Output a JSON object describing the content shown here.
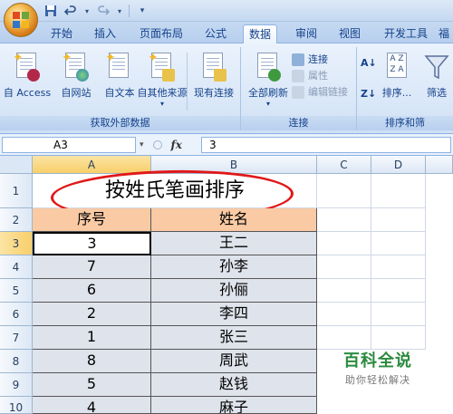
{
  "quick_access": {
    "save_icon": "save-icon",
    "undo_icon": "undo-icon",
    "redo_icon": "redo-icon",
    "customize_icon": "chevron-down-icon"
  },
  "tabs": [
    {
      "label": "开始"
    },
    {
      "label": "插入"
    },
    {
      "label": "页面布局"
    },
    {
      "label": "公式"
    },
    {
      "label": "数据",
      "active": true
    },
    {
      "label": "审阅"
    },
    {
      "label": "视图"
    },
    {
      "label": "开发工具"
    },
    {
      "label": "福"
    }
  ],
  "ribbon": {
    "get_external": {
      "label": "获取外部数据",
      "buttons": [
        "自 Access",
        "自网站",
        "自文本",
        "自其他来源",
        "现有连接"
      ]
    },
    "connections": {
      "label": "连接",
      "refresh_all": "全部刷新",
      "connect": "连接",
      "properties": "属性",
      "edit_links": "编辑链接"
    },
    "sort_filter": {
      "label": "排序和筛",
      "sort": "排序...",
      "filter": "筛选"
    }
  },
  "formula_bar": {
    "name_box": "A3",
    "fx_label": "fx",
    "formula": "3"
  },
  "sheet": {
    "columns": [
      "A",
      "B",
      "C",
      "D"
    ],
    "rows": [
      "1",
      "2",
      "3",
      "4",
      "5",
      "6",
      "7",
      "8",
      "9",
      "10"
    ],
    "title": "按姓氏笔画排序",
    "header": {
      "a": "序号",
      "b": "姓名"
    },
    "data": [
      {
        "no": "3",
        "name": "王二"
      },
      {
        "no": "7",
        "name": "孙李"
      },
      {
        "no": "6",
        "name": "孙俪"
      },
      {
        "no": "2",
        "name": "李四"
      },
      {
        "no": "1",
        "name": "张三"
      },
      {
        "no": "8",
        "name": "周武"
      },
      {
        "no": "5",
        "name": "赵钱"
      },
      {
        "no": "4",
        "name": "麻子"
      }
    ],
    "active_cell": "A3"
  },
  "watermark": {
    "title": "百科全说",
    "subtitle": "助你轻松解决"
  },
  "colors": {
    "ribbon_bg": "#dbe8f8",
    "header_fill": "#f9caa4",
    "data_fill": "#dfe3ec",
    "annotation_red": "#e01818",
    "watermark_green": "#2a8a3e"
  }
}
